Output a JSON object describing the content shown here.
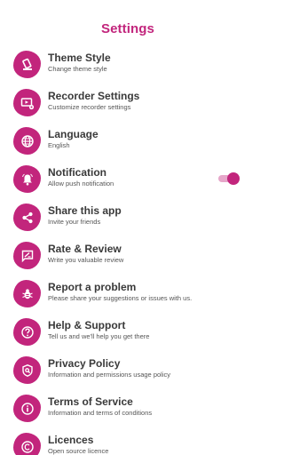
{
  "header": {
    "title": "Settings"
  },
  "colors": {
    "accent": "#c2257c",
    "toggle_track": "#e6a6c9",
    "title_text": "#3a3a3a",
    "subtitle_text": "#555555"
  },
  "settings": {
    "items": [
      {
        "title": "Theme Style",
        "subtitle": "Change theme style",
        "icon": "brush-icon"
      },
      {
        "title": "Recorder Settings",
        "subtitle": "Customize recorder settings",
        "icon": "recorder-settings-icon"
      },
      {
        "title": "Language",
        "subtitle": "English",
        "icon": "globe-icon"
      },
      {
        "title": "Notification",
        "subtitle": "Allow push notification",
        "icon": "bell-icon",
        "toggle_on": true
      },
      {
        "title": "Share this app",
        "subtitle": "Invite your friends",
        "icon": "share-icon"
      },
      {
        "title": "Rate & Review",
        "subtitle": "Write you valuable review",
        "icon": "rate-review-icon"
      },
      {
        "title": "Report a problem",
        "subtitle": "Please share your suggestions or issues with us.",
        "icon": "bug-icon"
      },
      {
        "title": "Help & Support",
        "subtitle": "Tell us and we'll help you get there",
        "icon": "help-icon"
      },
      {
        "title": "Privacy Policy",
        "subtitle": "Information and permissions usage policy",
        "icon": "privacy-icon"
      },
      {
        "title": "Terms of Service",
        "subtitle": "Information and terms of conditions",
        "icon": "info-icon"
      },
      {
        "title": "Licences",
        "subtitle": "Open source licence",
        "icon": "copyright-icon"
      }
    ]
  }
}
